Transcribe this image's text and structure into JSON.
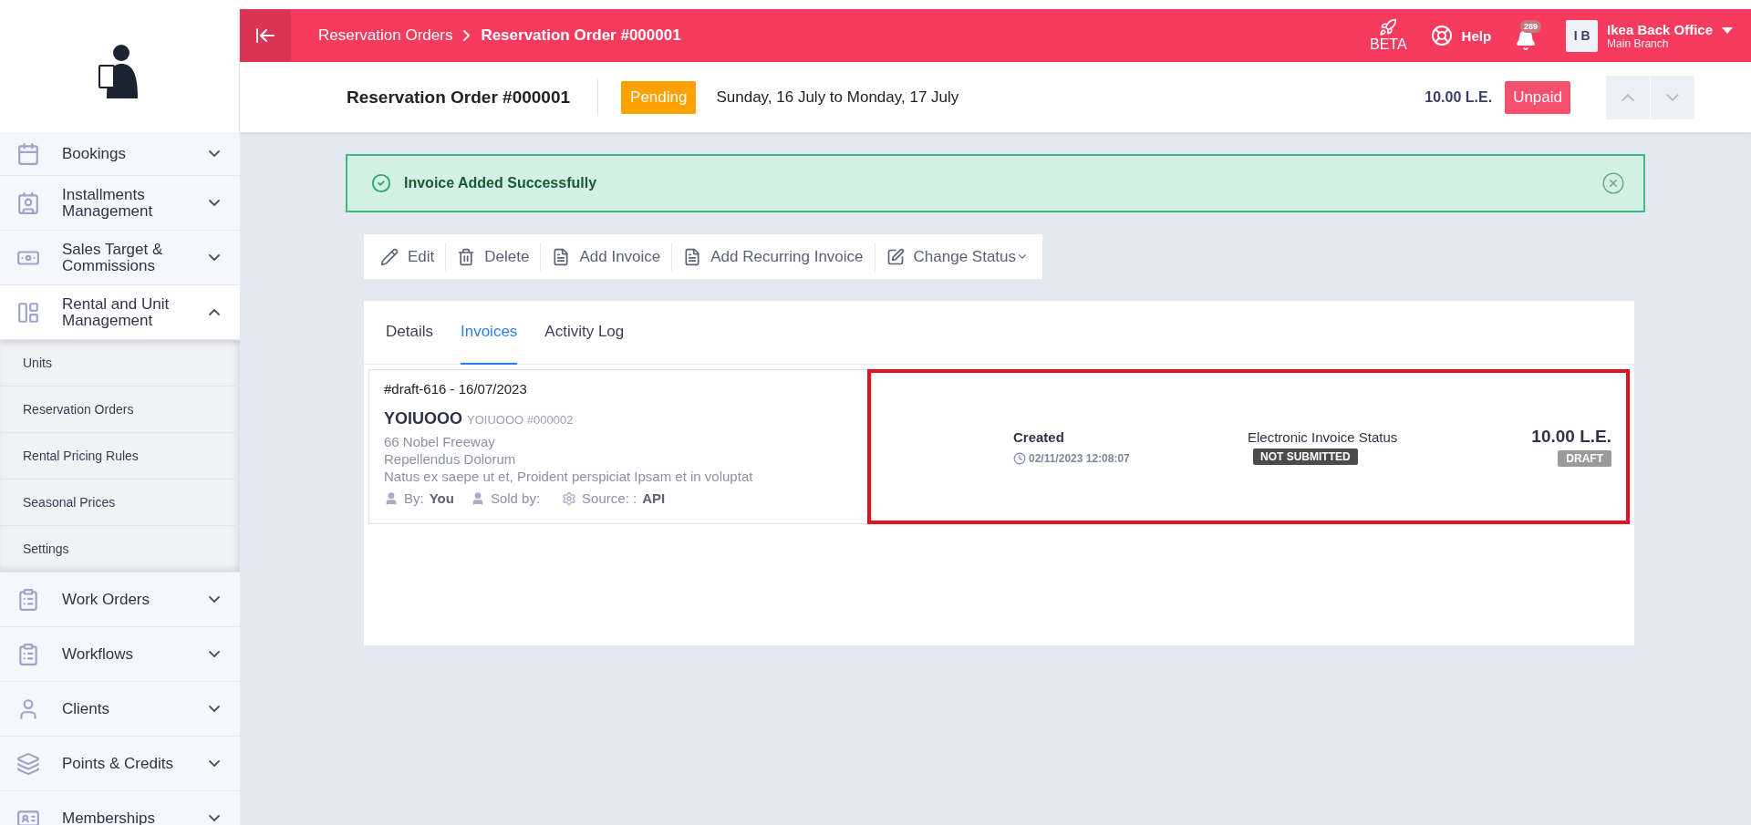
{
  "sidebar": {
    "items": [
      {
        "label": "Bookings",
        "expanded": false
      },
      {
        "label": "Installments Management",
        "expanded": false
      },
      {
        "label": "Sales Target & Commissions",
        "expanded": false
      },
      {
        "label": "Rental and Unit Management",
        "expanded": true,
        "children": [
          {
            "label": "Units"
          },
          {
            "label": "Reservation Orders"
          },
          {
            "label": "Rental Pricing Rules"
          },
          {
            "label": "Seasonal Prices"
          },
          {
            "label": "Settings"
          }
        ]
      },
      {
        "label": "Work Orders",
        "expanded": false
      },
      {
        "label": "Workflows",
        "expanded": false
      },
      {
        "label": "Clients",
        "expanded": false
      },
      {
        "label": "Points & Credits",
        "expanded": false
      },
      {
        "label": "Memberships",
        "expanded": false
      }
    ]
  },
  "top_bar": {
    "breadcrumbs": [
      {
        "label": "Reservation Orders"
      },
      {
        "label": "Reservation Order #000001"
      }
    ],
    "beta": "BETA",
    "help": "Help",
    "notifications": "289",
    "user": {
      "initials": "I B",
      "name": "Ikea Back Office",
      "branch": "Main Branch"
    }
  },
  "header": {
    "title": "Reservation Order #000001",
    "status": "Pending",
    "dates": "Sunday, 16 July to Monday, 17 July",
    "amount": "10.00 L.E.",
    "payment_status": "Unpaid"
  },
  "alert": {
    "message": "Invoice Added Successfully"
  },
  "actions": [
    {
      "label": "Edit"
    },
    {
      "label": "Delete"
    },
    {
      "label": "Add Invoice"
    },
    {
      "label": "Add Recurring Invoice"
    },
    {
      "label": "Change Status"
    }
  ],
  "tabs": [
    {
      "label": "Details",
      "selected": false
    },
    {
      "label": "Invoices",
      "selected": true
    },
    {
      "label": "Activity Log",
      "selected": false
    }
  ],
  "invoice": {
    "number_date": "#draft-616 - 16/07/2023",
    "client_name": "YOIUOOO",
    "client_code": "YOIUOOO #000002",
    "address": [
      "66 Nobel Freeway",
      "Repellendus Dolorum",
      "Natus ex saepe ut et, Proident perspiciat Ipsam et in voluptat"
    ],
    "by_label": "By:",
    "by_value": "You",
    "sold_by_label": "Sold by:",
    "source_label": "Source: :",
    "source_value": "API",
    "created_label": "Created",
    "created_at": "02/11/2023 12:08:07",
    "einvoice_label": "Electronic Invoice Status",
    "einvoice_status": "NOT SUBMITTED",
    "total": "10.00 L.E.",
    "status": "DRAFT",
    "highlighted": true
  }
}
